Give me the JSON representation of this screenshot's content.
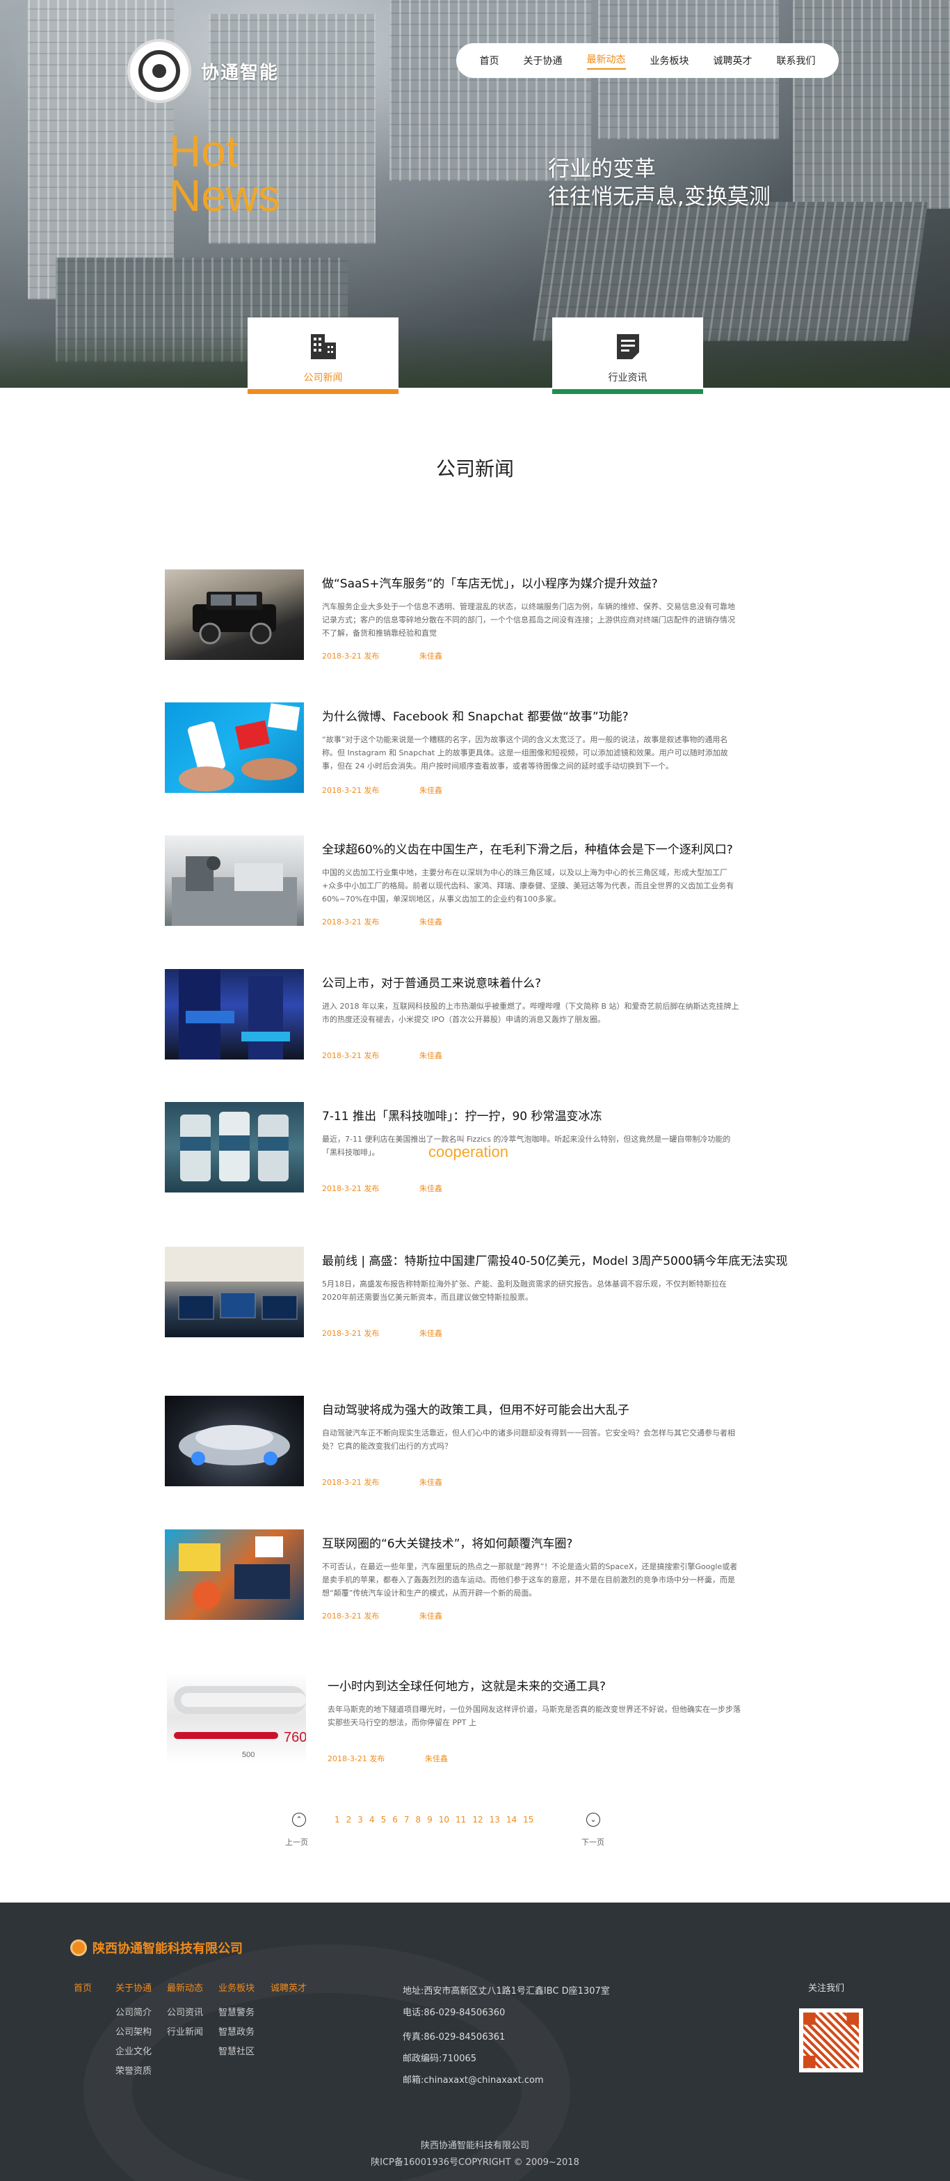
{
  "brand": {
    "name": "协通智能"
  },
  "nav": {
    "items": [
      "首页",
      "关于协通",
      "最新动态",
      "业务板块",
      "诚聘英才",
      "联系我们"
    ],
    "active": "最新动态"
  },
  "hero": {
    "hot": "Hot",
    "news": "News",
    "slogan_line1": "行业的变革",
    "slogan_line2": "往往悄无声息,变换莫测"
  },
  "tabs": [
    {
      "label": "公司新闻",
      "icon": "building-icon"
    },
    {
      "label": "行业资讯",
      "icon": "document-icon"
    }
  ],
  "section_title": "公司新闻",
  "news": [
    {
      "title": "做“SaaS+汽车服务”的「车店无忧」，以小程序为媒介提升效益?",
      "desc": "汽车服务企业大多处于一个信息不透明、管理混乱的状态，以终端服务门店为例，车辆的维修、保养、交易信息没有可靠地记录方式；客户的信息零碎地分散在不同的部门，一个个信息孤岛之间没有连接；上游供应商对终端门店配件的进销存情况不了解，备货和推销靠经验和直觉",
      "date": "2018-3-21 发布",
      "author": "朱佳鑫"
    },
    {
      "title": "为什么微博、Facebook 和 Snapchat 都要做“故事”功能?",
      "desc": "“故事”对于这个功能来说是一个糟糕的名字，因为故事这个词的含义太宽泛了。用一般的说法，故事是叙述事物的通用名称。但 Instagram 和 Snapchat 上的故事更具体。这是一组图像和短视频，可以添加滤镜和效果。用户可以随时添加故事，但在 24 小时后会消失。用户按时间顺序查看故事，或者等待图像之间的延时或手动切换到下一个。",
      "date": "2018-3-21 发布",
      "author": "朱佳鑫"
    },
    {
      "title": "全球超60%的义齿在中国生产，在毛利下滑之后，种植体会是下一个逐利风口?",
      "desc": "中国的义齿加工行业集中地，主要分布在以深圳为中心的珠三角区域，以及以上海为中心的长三角区域，形成大型加工厂+众多中小加工厂的格局。前者以现代齿科、家鸿、拜瑞、康泰健、坚膜、美冠达等为代表，而且全世界的义齿加工业务有60%~70%在中国，单深圳地区，从事义齿加工的企业约有100多家。",
      "date": "2018-3-21 发布",
      "author": "朱佳鑫"
    },
    {
      "title": "公司上市，对于普通员工来说意味着什么?",
      "desc": "进入 2018 年以来，互联网科技股的上市热潮似乎被重燃了。哔哩哔哩（下文简称 B 站）和爱奇艺前后脚在纳斯达克挂牌上市的热度还没有褪去，小米提交 IPO（首次公开募股）申请的消息又轰炸了朋友圈。",
      "date": "2018-3-21 发布",
      "author": "朱佳鑫"
    },
    {
      "title": "7-11 推出「黑科技咖啡」：拧一拧，90 秒常温变冰冻",
      "desc": "最近，7-11 便利店在美国推出了一款名叫 Fizzics 的冷萃气泡咖啡。听起来没什么特别，但这竟然是一罐自带制冷功能的「黑科技咖啡」。",
      "date": "2018-3-21 发布",
      "author": "朱佳鑫"
    },
    {
      "title": "最前线 | 高盛：特斯拉中国建厂需投40-50亿美元，Model 3周产5000辆今年底无法实现",
      "desc": "5月18日，高盛发布报告称特斯拉海外扩张、产能、盈利及融资需求的研究报告。总体基调不容乐观，不仅判断特斯拉在2020年前还需要当亿美元新资本，而且建议做空特斯拉股票。",
      "date": "2018-3-21 发布",
      "author": "朱佳鑫"
    },
    {
      "title": "自动驾驶将成为强大的政策工具，但用不好可能会出大乱子",
      "desc": "自动驾驶汽车正不断向现实生活靠近，但人们心中的诸多问题却没有得到一一回答。它安全吗？会怎样与其它交通参与者相处？它真的能改变我们出行的方式吗？",
      "date": "2018-3-21 发布",
      "author": "朱佳鑫"
    },
    {
      "title": "互联网圈的“6大关键技术”，将如何颠覆汽车圈?",
      "desc": "不可否认，在最近一些年里，汽车圈里玩的热点之一那就是“跨界”！不论是造火箭的SpaceX，还是搞搜索引擎Google或者是卖手机的苹果，都卷入了轰轰烈烈的造车运动。而他们参于这车的意愿，并不是在目前激烈的竞争市场中分一杯羹，而是想“颠覆”传统汽车设计和生产的模式，从而开辟一个新的局面。",
      "date": "2018-3-21 发布",
      "author": "朱佳鑫"
    },
    {
      "title": "一小时内到达全球任何地方，这就是未来的交通工具?",
      "desc": "去年马斯克的地下隧道项目曝光时，一位外国网友这样评价道，马斯克是否真的能改变世界还不好说，但他确实在一步步落实那些天马行空的想法，而你停留在 PPT 上",
      "date": "2018-3-21 发布",
      "author": "朱佳鑫"
    }
  ],
  "cooperation": "cooperation",
  "pager": {
    "prev": "上一页",
    "next": "下一页",
    "pages": [
      "1",
      "2",
      "3",
      "4",
      "5",
      "6",
      "7",
      "8",
      "9",
      "10",
      "11",
      "12",
      "13",
      "14",
      "15"
    ]
  },
  "footer": {
    "company": "陕西协通智能科技有限公司",
    "col1": {
      "head": "首页"
    },
    "col2": {
      "head": "关于协通",
      "items": [
        "公司简介",
        "公司架构",
        "企业文化",
        "荣誉资质"
      ]
    },
    "col3": {
      "head": "最新动态",
      "items": [
        "公司资讯",
        "行业新闻"
      ]
    },
    "col4": {
      "head": "业务板块",
      "items": [
        "智慧警务",
        "智慧政务",
        "智慧社区"
      ]
    },
    "col5": {
      "head": "诚聘英才"
    },
    "address": "地址:西安市高新区丈八1路1号汇鑫IBC D座1307室",
    "phone": "电话:86-029-84506360",
    "fax": "传真:86-029-84506361",
    "postcode": "邮政编码:710065",
    "email": "邮箱:chinaxaxt@chinaxaxt.com",
    "follow": "关注我们",
    "copy1": "陕西协通智能科技有限公司",
    "copy2": "陕ICP备16001936号COPYRIGHT © 2009~2018"
  }
}
